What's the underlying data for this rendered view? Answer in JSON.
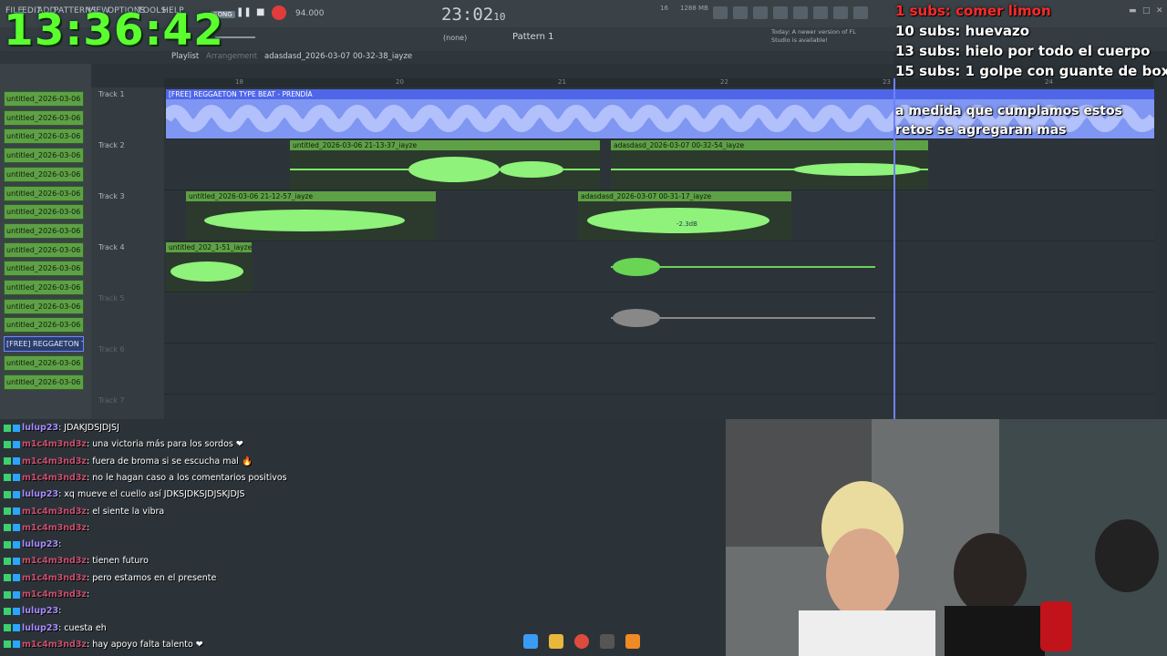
{
  "clock": "13:36:42",
  "menu": [
    "FILE",
    "EDIT",
    "ADD",
    "PATTERNS",
    "VIEW",
    "OPTIONS",
    "TOOLS",
    "HELP"
  ],
  "transport": {
    "mode": "SONG",
    "tempo": "94.000",
    "song_time": "23:02",
    "song_time_small": "10",
    "memory": "1288 MB",
    "cpu": "16"
  },
  "toolbar": {
    "pattern_label": "Pattern 1",
    "preset": "(none)",
    "update_note": "Today: A newer version of FL Studio is available!"
  },
  "playlist": {
    "title": "Playlist",
    "subtitle": "Arrangement",
    "file": "adasdasd_2026-03-07 00-32-38_iayze"
  },
  "ruler": [
    "18",
    "20",
    "21",
    "22",
    "23",
    "24"
  ],
  "patterns": [
    {
      "label": "untitled_2026-03-06 20-"
    },
    {
      "label": "untitled_2026-03-06 20-"
    },
    {
      "label": "untitled_2026-03-06 20-"
    },
    {
      "label": "untitled_2026-03-06 20-"
    },
    {
      "label": "untitled_2026-03-06 20-"
    },
    {
      "label": "untitled_2026-03-06 20-"
    },
    {
      "label": "untitled_2026-03-06 20-"
    },
    {
      "label": "untitled_2026-03-06 20-"
    },
    {
      "label": "untitled_2026-03-06 20-"
    },
    {
      "label": "untitled_2026-03-06 20-"
    },
    {
      "label": "untitled_2026-03-06 20-"
    },
    {
      "label": "untitled_2026-03-06 20-"
    },
    {
      "label": "untitled_2026-03-06 20-"
    },
    {
      "label": "[FREE] REGGAETON T..."
    },
    {
      "label": "untitled_2026-03-06 20-"
    },
    {
      "label": "untitled_2026-03-06 20-"
    }
  ],
  "tracks": [
    "Track 1",
    "Track 2",
    "Track 3",
    "Track 4",
    "Track 5",
    "Track 6",
    "Track 7"
  ],
  "clips": {
    "t1": "[FREE] REGGAETON TYPE BEAT - PRENDÍA",
    "t2a": "untitled_2026-03-06 21-13-37_iayze",
    "t2b": "adasdasd_2026-03-07 00-32-54_iayze",
    "t3a": "untitled_2026-03-06 21-12-57_iayze",
    "t3b": "adasdasd_2026-03-07 00-31-17_iayze",
    "t4a": "untitled_202_1-51_iayze",
    "gain": "-2.3dB"
  },
  "subs": [
    {
      "text": "1 subs: comer limon",
      "color": "#ff2a2a"
    },
    {
      "text": "10 subs: huevazo",
      "color": "#ffffff"
    },
    {
      "text": "13 subs: hielo por todo el cuerpo",
      "color": "#ffffff"
    },
    {
      "text": "15 subs: 1 golpe con guante de box",
      "color": "#ffffff"
    }
  ],
  "note": "a medida que cumplamos estos retos se agregaran mas",
  "chat": [
    {
      "user": "lulup23",
      "text": "JDAKJDSJDJSJ"
    },
    {
      "user": "m1c4m3nd3z",
      "text": "una victoria más para los sordos ❤"
    },
    {
      "user": "m1c4m3nd3z",
      "text": "fuera de broma si se escucha mal 🔥"
    },
    {
      "user": "m1c4m3nd3z",
      "text": "no le hagan caso a los comentarios positivos"
    },
    {
      "user": "lulup23",
      "text": "xq mueve el cuello así JDKSJDKSJDJSKJDJS"
    },
    {
      "user": "m1c4m3nd3z",
      "text": "el siente la vibra"
    },
    {
      "user": "m1c4m3nd3z",
      "text": ""
    },
    {
      "user": "lulup23",
      "text": ""
    },
    {
      "user": "m1c4m3nd3z",
      "text": "tienen futuro"
    },
    {
      "user": "m1c4m3nd3z",
      "text": "pero estamos en el presente"
    },
    {
      "user": "m1c4m3nd3z",
      "text": ""
    },
    {
      "user": "lulup23",
      "text": ""
    },
    {
      "user": "lulup23",
      "text": "cuesta eh"
    },
    {
      "user": "m1c4m3nd3z",
      "text": "hay apoyo falta talento ❤"
    }
  ]
}
